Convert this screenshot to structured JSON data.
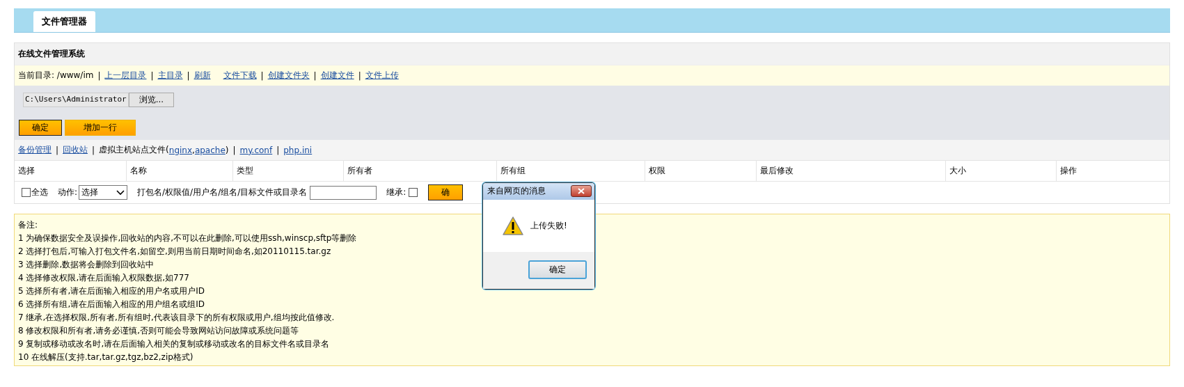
{
  "tabs": [
    {
      "label": "文件管理器",
      "selected": true
    }
  ],
  "panel_title": "在线文件管理系统",
  "path_bar": [
    {
      "kind": "text",
      "text": "当前目录: /www/im"
    },
    {
      "kind": "sep",
      "text": "|"
    },
    {
      "kind": "link",
      "text": "上一层目录"
    },
    {
      "kind": "sep",
      "text": "|"
    },
    {
      "kind": "link",
      "text": "主目录"
    },
    {
      "kind": "sep",
      "text": "|"
    },
    {
      "kind": "link",
      "text": "刷新"
    },
    {
      "kind": "link",
      "text": "文件下载"
    },
    {
      "kind": "sep",
      "text": "|"
    },
    {
      "kind": "link",
      "text": "创建文件夹"
    },
    {
      "kind": "sep",
      "text": "|"
    },
    {
      "kind": "link",
      "text": "创建文件"
    },
    {
      "kind": "sep",
      "text": "|"
    },
    {
      "kind": "link",
      "text": "文件上传"
    }
  ],
  "upload": {
    "file_value": "C:\\Users\\Administrator",
    "browse_button": "浏览...",
    "buttons": [
      "确定",
      "增加一行"
    ]
  },
  "tools_bar": [
    {
      "kind": "link",
      "text": "备份管理"
    },
    {
      "kind": "sep",
      "text": "|"
    },
    {
      "kind": "link",
      "text": "回收站"
    },
    {
      "kind": "sep",
      "text": "|"
    },
    {
      "kind": "text",
      "text": "虚拟主机站点文件("
    },
    {
      "kind": "link",
      "text": "nginx"
    },
    {
      "kind": "text",
      "text": ","
    },
    {
      "kind": "link",
      "text": "apache"
    },
    {
      "kind": "text",
      "text": ")"
    },
    {
      "kind": "sep",
      "text": "|"
    },
    {
      "kind": "link",
      "text": "my.conf"
    },
    {
      "kind": "sep",
      "text": "|"
    },
    {
      "kind": "link",
      "text": "php.ini"
    }
  ],
  "table": {
    "columns": [
      "选择",
      "名称",
      "类型",
      "所有者",
      "所有组",
      "权限",
      "最后修改",
      "大小",
      "操作"
    ]
  },
  "actions": {
    "select_all": {
      "label": "全选",
      "checked": false
    },
    "action_label": "动作:",
    "action_value": "选择",
    "target_label": "打包名/权限值/用户名/组名/目标文件或目录名",
    "inherit": {
      "label": "继承:",
      "checked": false
    },
    "submit": "确"
  },
  "notes": {
    "title": "备注:",
    "lines": [
      "1 为确保数据安全及误操作,回收站的内容,不可以在此删除,可以使用ssh,winscp,sftp等删除",
      "2 选择打包后,可输入打包文件名,如留空,则用当前日期时间命名,如20110115.tar.gz",
      "3 选择删除,数据将会删除到回收站中",
      "4 选择修改权限,请在后面输入权限数据,如777",
      "5 选择所有者,请在后面输入相应的用户名或用户ID",
      "6 选择所有组,请在后面输入相应的用户组名或组ID",
      "7 继承,在选择权限,所有者,所有组时,代表该目录下的所有权限或用户,组均按此值修改.",
      "8 修改权限和所有者,请务必谨慎,否则可能会导致网站访问故障或系统问题等",
      "9 复制或移动或改名时,请在后面输入相关的复制或移动或改名的目标文件名或目录名",
      "10 在线解压(支持.tar,tar.gz,tgz,bz2,zip格式)"
    ]
  },
  "dialog": {
    "title": "来自网页的消息",
    "message": "上传失败!",
    "button": "确定"
  }
}
